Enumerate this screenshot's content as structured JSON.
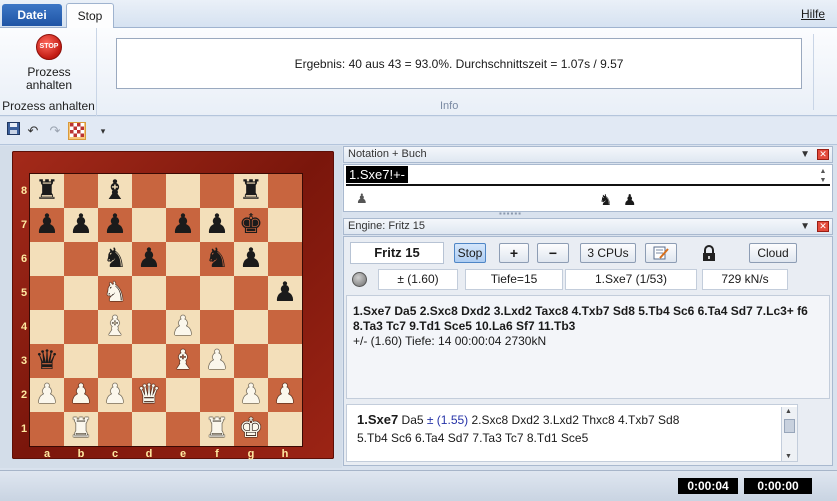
{
  "tabs": {
    "file": "Datei",
    "stop": "Stop",
    "help": "Hilfe"
  },
  "ribbon": {
    "stop_icon_text": "STOP",
    "stop_button_label_1": "Prozess",
    "stop_button_label_2": "anhalten",
    "group_label": "Prozess anhalten",
    "result_text": "Ergebnis: 40 aus 43 = 93.0%. Durchschnittszeit = 1.07s / 9.57",
    "info_label": "Info"
  },
  "board": {
    "ranks": [
      "8",
      "7",
      "6",
      "5",
      "4",
      "3",
      "2",
      "1"
    ],
    "files": [
      "a",
      "b",
      "c",
      "d",
      "e",
      "f",
      "g",
      "h"
    ],
    "rows": [
      [
        "bR",
        "",
        "bB",
        "",
        "",
        "",
        "bR",
        ""
      ],
      [
        "bP",
        "bP",
        "bP",
        "",
        "bP",
        "bP",
        "bK",
        ""
      ],
      [
        "",
        "",
        "bN",
        "bP",
        "",
        "bN",
        "bP",
        ""
      ],
      [
        "",
        "",
        "wN",
        "",
        "",
        "",
        "",
        "bP"
      ],
      [
        "",
        "",
        "wB",
        "",
        "wP",
        "",
        "",
        ""
      ],
      [
        "bQ",
        "",
        "",
        "",
        "wB",
        "wP",
        "",
        ""
      ],
      [
        "wP",
        "wP",
        "wP",
        "wQ",
        "",
        "",
        "wP",
        "wP"
      ],
      [
        "",
        "wR",
        "",
        "",
        "",
        "wR",
        "wK",
        ""
      ]
    ]
  },
  "notation": {
    "title": "Notation + Buch",
    "move": "1.Sxe7!+-",
    "grip": "▪▪▪▪▪▪"
  },
  "engine": {
    "title": "Engine: Fritz 15",
    "name": "Fritz 15",
    "stop_label": "Stop",
    "add_label": "+",
    "remove_label": "−",
    "cpus_label": "3 CPUs",
    "cloud_label": "Cloud",
    "eval": "±  (1.60)",
    "depth": "Tiefe=15",
    "current_move": "1.Sxe7 (1/53)",
    "speed": "729 kN/s",
    "pv_line": "1.Sxe7 Da5 2.Sxc8 Dxd2 3.Lxd2 Taxc8 4.Txb7 Sd8 5.Tb4 Sc6 6.Ta4 Sd7 7.Lc3+ f6 8.Ta3 Tc7 9.Td1 Sce5 10.La6 Sf7 11.Tb3",
    "pv_meta": "+/-  (1.60)    Tiefe: 14    00:00:04   2730kN",
    "variation": {
      "first_move": "1.Sxe7",
      "reply": " Da5 ",
      "eval": "± (1.55)",
      "rest_1": " 2.Sxc8  Dxd2  3.Lxd2  Thxc8  4.Txb7  Sd8",
      "rest_2": "5.Tb4  Sc6  6.Ta4  Sd7  7.Ta3  Tc7  8.Td1  Sce5"
    }
  },
  "status": {
    "clock_white": "0:00:04",
    "clock_black": "0:00:00"
  },
  "icons": {
    "save": "save-icon",
    "undo": "undo-icon",
    "redo": "redo-icon",
    "board_active": "chessboard-icon",
    "lock": "lock-icon",
    "edit": "notepad-icon"
  }
}
